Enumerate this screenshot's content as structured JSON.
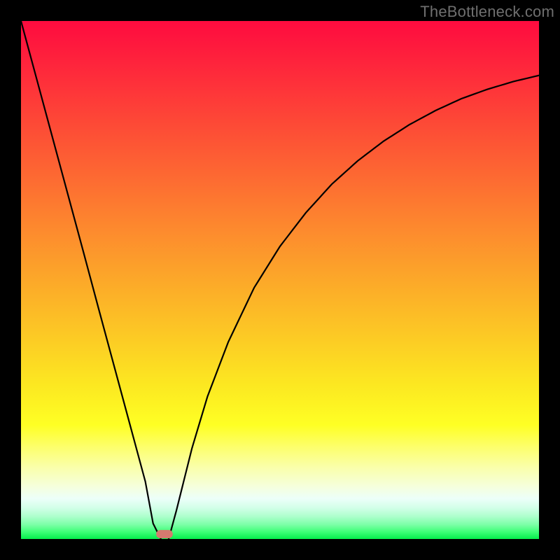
{
  "watermark": "TheBottleneck.com",
  "chart_data": {
    "type": "line",
    "title": "",
    "xlabel": "",
    "ylabel": "",
    "xlim": [
      0,
      100
    ],
    "ylim": [
      0,
      100
    ],
    "grid": false,
    "legend": false,
    "annotations": [
      {
        "text": "TheBottleneck.com",
        "position": "top-right",
        "color": "#6f6f6f"
      }
    ],
    "series": [
      {
        "name": "left-branch",
        "x": [
          0,
          3,
          6,
          9,
          12,
          15,
          18,
          21,
          24,
          25.5,
          27
        ],
        "y": [
          100,
          88.9,
          77.8,
          66.7,
          55.6,
          44.4,
          33.3,
          22.2,
          11.1,
          3.0,
          0
        ]
      },
      {
        "name": "right-branch",
        "x": [
          28.5,
          30,
          33,
          36,
          40,
          45,
          50,
          55,
          60,
          65,
          70,
          75,
          80,
          85,
          90,
          95,
          100
        ],
        "y": [
          0,
          5.5,
          17.5,
          27.5,
          38.0,
          48.5,
          56.5,
          63.0,
          68.5,
          73.0,
          76.8,
          80.0,
          82.7,
          85.0,
          86.8,
          88.3,
          89.5
        ]
      }
    ],
    "marker": {
      "x_center": 27.7,
      "width": 3.2,
      "height": 1.6,
      "color": "#d57a6f"
    },
    "background_gradient": {
      "stops": [
        {
          "offset": 0.0,
          "color": "#fe0b3f"
        },
        {
          "offset": 0.1,
          "color": "#fe2a3b"
        },
        {
          "offset": 0.2,
          "color": "#fd4a36"
        },
        {
          "offset": 0.3,
          "color": "#fd6932"
        },
        {
          "offset": 0.4,
          "color": "#fd892e"
        },
        {
          "offset": 0.5,
          "color": "#fca829"
        },
        {
          "offset": 0.6,
          "color": "#fcc725"
        },
        {
          "offset": 0.7,
          "color": "#fce721"
        },
        {
          "offset": 0.78,
          "color": "#feff24"
        },
        {
          "offset": 0.82,
          "color": "#fdff68"
        },
        {
          "offset": 0.86,
          "color": "#faffa8"
        },
        {
          "offset": 0.9,
          "color": "#f5ffde"
        },
        {
          "offset": 0.922,
          "color": "#ecfff9"
        },
        {
          "offset": 0.94,
          "color": "#d2ffe8"
        },
        {
          "offset": 0.956,
          "color": "#aeffcd"
        },
        {
          "offset": 0.972,
          "color": "#7dffa8"
        },
        {
          "offset": 0.986,
          "color": "#3fff78"
        },
        {
          "offset": 1.0,
          "color": "#05ee4c"
        }
      ]
    }
  }
}
